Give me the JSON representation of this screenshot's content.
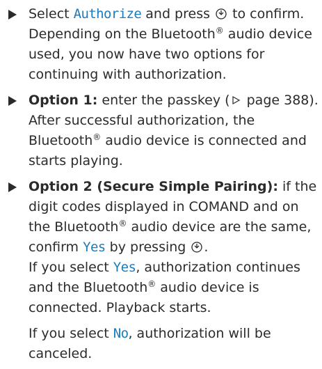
{
  "step1": {
    "before": "Select ",
    "ui": "Authorize",
    "after": " and press ",
    "after2": " to confirm.",
    "line2": "Depending on the Bluetooth",
    "line2b": " audio device",
    "line3": "used, you now have two options for",
    "line4": "continuing with authorization."
  },
  "step2": {
    "label": "Option 1:",
    "text": " enter the passkey (",
    "page_ref": " page 388).",
    "line2": "After successful authorization, the",
    "line3a": "Bluetooth",
    "line3b": " audio device is connected and",
    "line4": "starts playing."
  },
  "step3": {
    "label": "Option 2 (Secure Simple Pairing):",
    "text": " if the",
    "line2": "digit codes displayed in COMAND and on",
    "line3a": "the Bluetooth",
    "line3b": " audio device are the same,",
    "line4a": "confirm ",
    "line4ui": "Yes",
    "line4b": " by pressing ",
    "line4c": ".",
    "p2_line1a": "If you select ",
    "p2_line1ui": "Yes",
    "p2_line1b": ", authorization continues",
    "p2_line2a": "and the Bluetooth",
    "p2_line2b": " audio device is",
    "p2_line3": "connected. Playback starts.",
    "p3_line1a": "If you select ",
    "p3_line1ui": "No",
    "p3_line1b": ", authorization will be",
    "p3_line2": "canceled."
  },
  "symbols": {
    "registered": "®",
    "knob_icon": "controller-knob-press-icon",
    "page_ref_icon": "page-reference-triangle-icon"
  },
  "colors": {
    "text": "#2b2b2b",
    "ui_label": "#1a7bbf"
  }
}
